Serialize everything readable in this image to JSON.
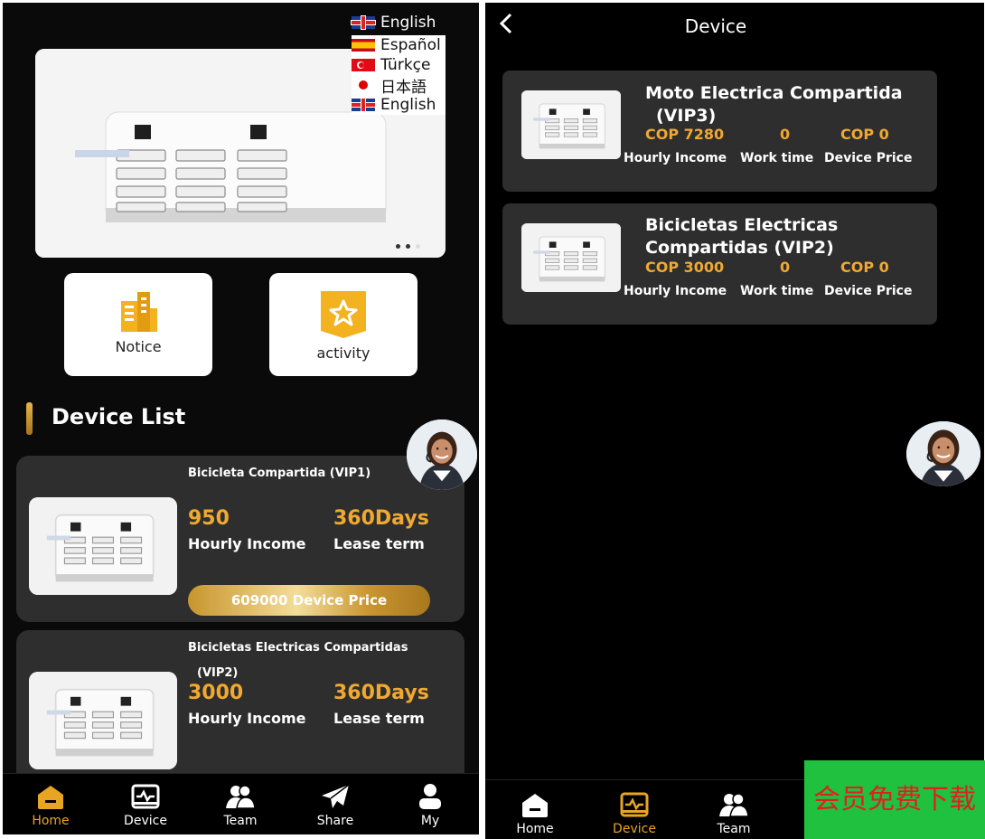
{
  "left_screen": {
    "language": {
      "current": "English",
      "options": [
        "Español",
        "Türkçe",
        "日本語",
        "English"
      ]
    },
    "quick_actions": {
      "notice_label": "Notice",
      "activity_label": "activity"
    },
    "section_title": "Device List",
    "devices": [
      {
        "name": "Bicicleta Compartida  (VIP1)",
        "income_value": "950",
        "income_label": "Hourly Income",
        "term_value": "360Days",
        "term_label": "Lease term",
        "price_button": "609000 Device Price"
      },
      {
        "name_line1": "Bicicletas Electricas Compartidas",
        "name_line2": "(VIP2)",
        "income_value": "3000",
        "income_label": "Hourly Income",
        "term_value": "360Days",
        "term_label": "Lease term"
      }
    ],
    "tabs": [
      "Home",
      "Device",
      "Team",
      "Share",
      "My"
    ],
    "active_tab": "Home"
  },
  "right_screen": {
    "title": "Device",
    "devices": [
      {
        "name_line1": "Moto Electrica Compartida",
        "name_line2": "(VIP3)",
        "income": "COP 7280",
        "work_time": "0",
        "price": "COP 0",
        "income_label": "Hourly Income",
        "work_time_label": "Work time",
        "price_label": "Device Price"
      },
      {
        "name_line1": "Bicicletas Electricas",
        "name_line2": "Compartidas  (VIP2)",
        "income": "COP 3000",
        "work_time": "0",
        "price": "COP 0",
        "income_label": "Hourly Income",
        "work_time_label": "Work time",
        "price_label": "Device Price"
      }
    ],
    "tabs": [
      "Home",
      "Device",
      "Team"
    ],
    "active_tab": "Device"
  },
  "watermark": "会员免费下载",
  "colors": {
    "accent": "#e8a524",
    "card_bg": "#2e2e2e",
    "watermark_bg": "#1fc13e",
    "watermark_text": "#e02020"
  },
  "icons": [
    "home-icon",
    "device-icon",
    "team-icon",
    "share-icon",
    "user-icon",
    "building-icon",
    "star-badge-icon",
    "back-chevron-icon",
    "uk-flag-icon",
    "spain-flag-icon",
    "turkey-flag-icon",
    "japan-flag-icon"
  ]
}
